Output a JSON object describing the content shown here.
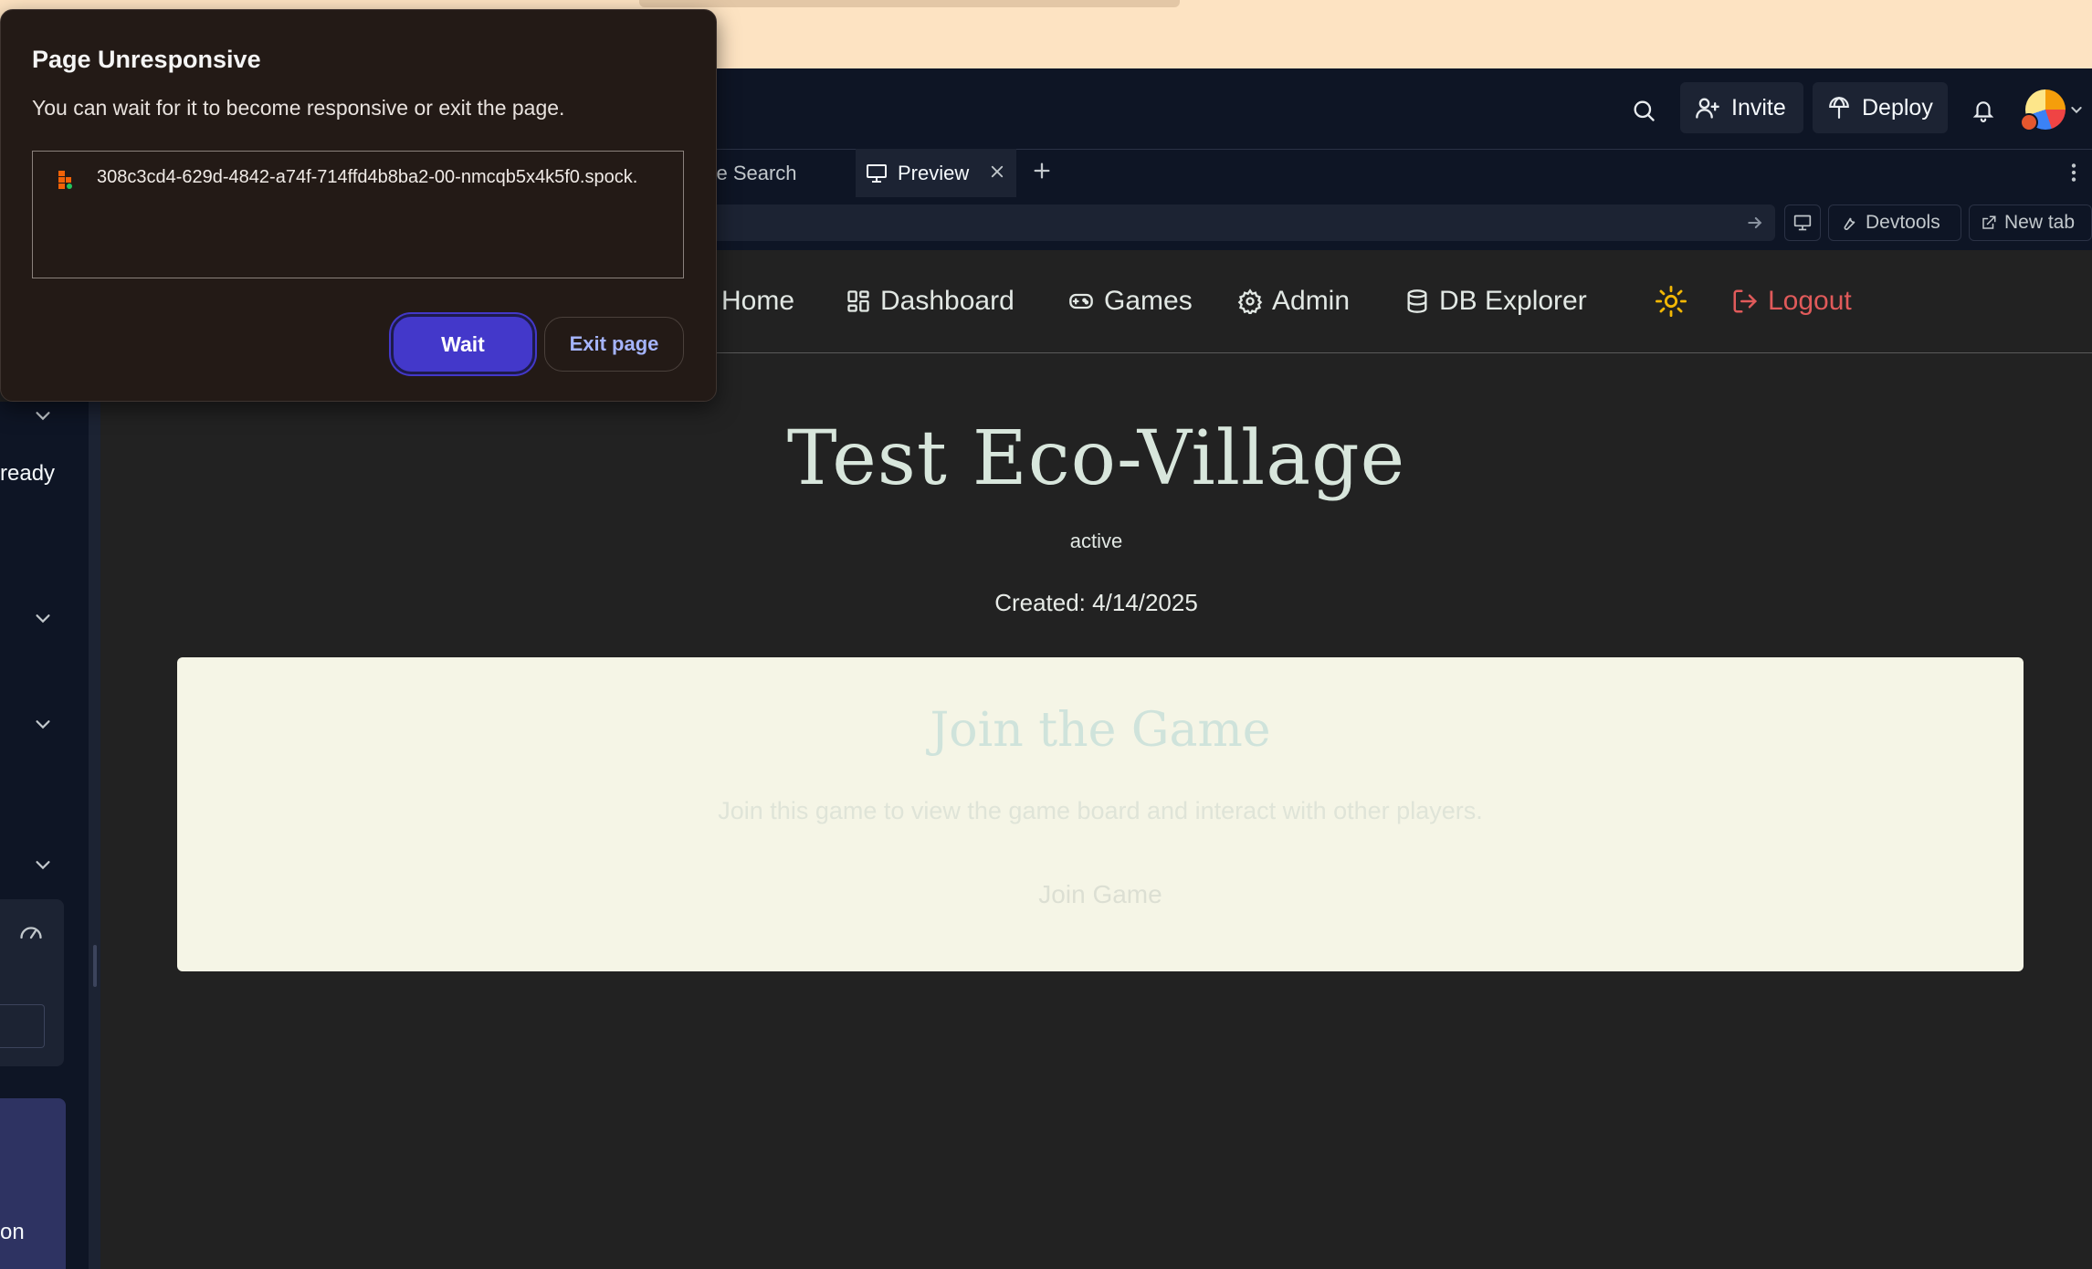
{
  "dialog": {
    "title": "Page Unresponsive",
    "message": "You can wait for it to become responsive or exit the page.",
    "page_url": "308c3cd4-629d-4842-a74f-714ffd4b8ba2-00-nmcqb5x4k5f0.spock.",
    "wait_label": "Wait",
    "exit_label": "Exit page"
  },
  "header": {
    "invite_label": "Invite",
    "deploy_label": "Deploy",
    "icons": [
      "search-icon",
      "invite-icon",
      "deploy-icon",
      "bell-icon",
      "avatar"
    ]
  },
  "tabs": {
    "items": [
      {
        "label": "ode Search"
      },
      {
        "label": "Preview"
      }
    ]
  },
  "url_bar": {
    "devtools_label": "Devtools",
    "new_tab_label": "New tab"
  },
  "sidebar": {
    "ready_text": "ready",
    "bottom_text": "on"
  },
  "preview": {
    "nav": {
      "home": "Home",
      "dashboard": "Dashboard",
      "games": "Games",
      "admin": "Admin",
      "db_explorer": "DB Explorer",
      "logout": "Logout"
    },
    "game_title": "Test Eco-Village",
    "status": "active",
    "created": "Created: 4/14/2025",
    "join": {
      "title": "Join the Game",
      "description": "Join this game to view the game board and interact with other players.",
      "button_label": "Join Game"
    }
  },
  "colors": {
    "banner": "#fde3c2",
    "header_bg": "#0e1525",
    "preview_bg": "#222222",
    "dialog_bg": "#231a16",
    "wait_button": "#4338ca",
    "logout": "#e05a5a",
    "join_card": "#f5f5e6"
  }
}
